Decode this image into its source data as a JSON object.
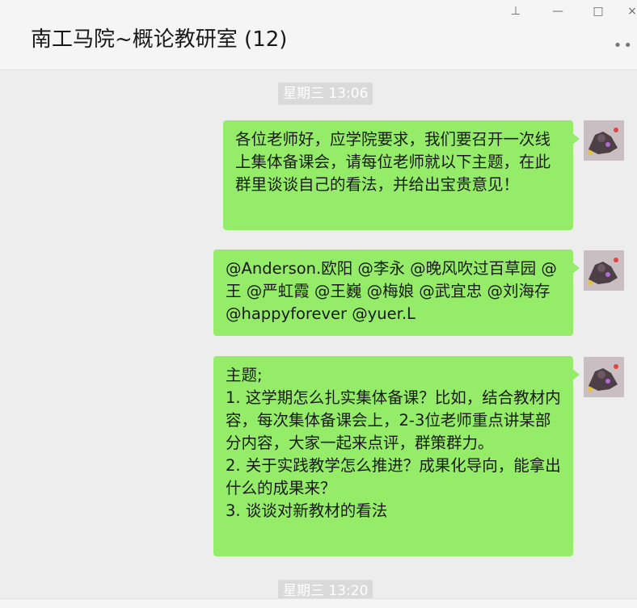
{
  "window": {
    "title": "南工马院~概论教研室 (12)",
    "controls": {
      "pin": "⊥",
      "minimize": "—",
      "maximize": "□",
      "close": "×"
    },
    "more": "••"
  },
  "chat": {
    "timestamps": [
      "星期三 13:06",
      "星期三 13:20"
    ],
    "messages": [
      {
        "text": "各位老师好，应学院要求，我们要召开一次线上集体备课会，请每位老师就以下主题，在此群里谈谈自己的看法，并给出宝贵意见！"
      },
      {
        "text": "@Anderson.欧阳 @李永 @晚风吹过百草园 @王 @严虹霞 @王巍 @梅娘 @武宜忠 @刘海存 @happyforever @yuer.L"
      },
      {
        "text": "主题;\n1. 这学期怎么扎实集体备课？比如，结合教材内容，每次集体备课会上，2-3位老师重点讲某部分内容，大家一起来点评，群策群力。\n2. 关于实践教学怎么推进？成果化导向，能拿出什么的成果来？\n3. 谈谈对新教材的看法"
      }
    ]
  },
  "colors": {
    "bubble": "#95ec69",
    "chat_bg": "#ededed",
    "titlebar_bg": "#f5f5f5"
  }
}
